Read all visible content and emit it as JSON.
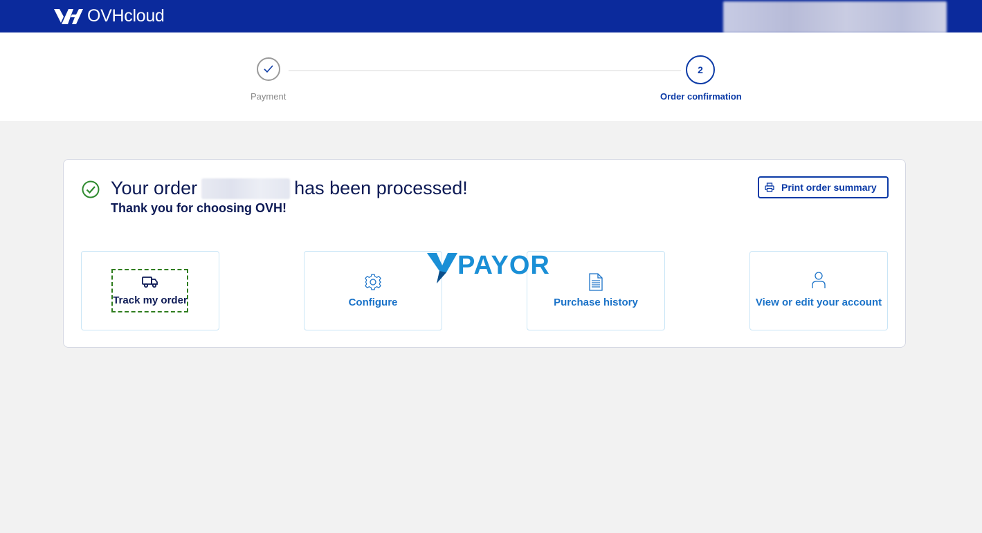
{
  "header": {
    "brand": "OVHcloud",
    "brand_color": "#0b2a9c"
  },
  "stepper": {
    "steps": [
      {
        "label": "Payment",
        "state": "completed",
        "icon": "checkmark-icon"
      },
      {
        "label": "Order confirmation",
        "number": "2",
        "state": "active"
      }
    ]
  },
  "confirmation": {
    "title_prefix": "Your order",
    "title_suffix": "has been processed!",
    "subtitle": "Thank you for choosing OVH!",
    "print_label": "Print order summary"
  },
  "actions": [
    {
      "label": "Track my order",
      "icon": "truck-icon"
    },
    {
      "label": "Configure",
      "icon": "gear-icon"
    },
    {
      "label": "Purchase history",
      "icon": "document-icon"
    },
    {
      "label": "View or edit your account",
      "icon": "user-icon"
    }
  ],
  "watermark": {
    "text": "PAYOR"
  }
}
